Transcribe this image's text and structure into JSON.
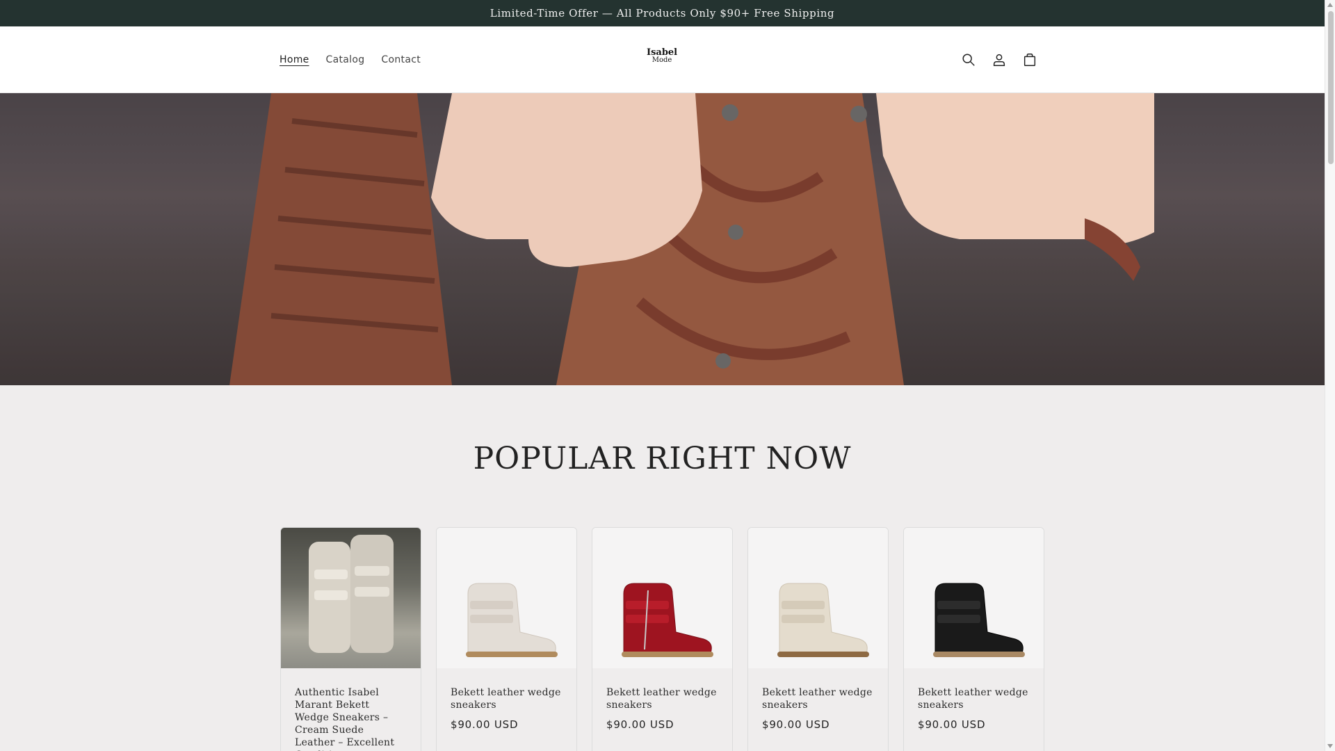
{
  "announcement": "Limited-Time Offer — All Products Only $90+ Free Shipping",
  "nav": {
    "items": [
      {
        "label": "Home",
        "active": true
      },
      {
        "label": "Catalog",
        "active": false
      },
      {
        "label": "Contact",
        "active": false
      }
    ]
  },
  "logo": {
    "line1": "Isabel",
    "line2": "Mode"
  },
  "header_icons": [
    "search-icon",
    "account-icon",
    "cart-icon"
  ],
  "section": {
    "title": "POPULAR RIGHT NOW"
  },
  "products": [
    {
      "name": "Authentic Isabel Marant Bekett Wedge Sneakers – Cream Suede Leather – Excellent Condition",
      "price": "",
      "color": "#d9d3c8"
    },
    {
      "name": "Bekett leather wedge sneakers",
      "price": "$90.00 USD",
      "color": "#e3ddd6"
    },
    {
      "name": "Bekett leather wedge sneakers",
      "price": "$90.00 USD",
      "color": "#9e1420"
    },
    {
      "name": "Bekett leather wedge sneakers",
      "price": "$90.00 USD",
      "color": "#e4dccd"
    },
    {
      "name": "Bekett leather wedge sneakers",
      "price": "$90.00 USD",
      "color": "#1a1a1a"
    }
  ],
  "colors": {
    "announcement_bg": "#243330",
    "page_bg": "#efeded",
    "header_bg": "#ffffff"
  }
}
